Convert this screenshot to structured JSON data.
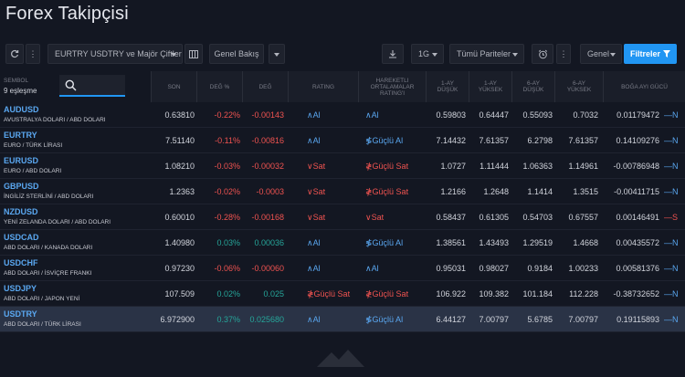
{
  "page": {
    "title": "Forex Takipçisi"
  },
  "toolbar": {
    "list_name": "EURTRY USDTRY ve Majör Çiftler",
    "view": "Genel Bakış",
    "interval": "1G",
    "filter_scope": "Tümü Pariteler",
    "column_set": "Genel",
    "filters_label": "Filtreler"
  },
  "table": {
    "symbol_header": "Sembol",
    "match_count": "9 eşleşme",
    "columns": [
      "Son",
      "Değ %",
      "Değ",
      "Rating",
      "Hareketli Ortalamalar Rating'i",
      "1-Ay Düşük",
      "1-Ay Yüksek",
      "6-Ay Düşük",
      "6-Ay Yüksek",
      "Boğa Ayı Gücü"
    ],
    "rows": [
      {
        "symbol": "AUDUSD",
        "desc": "AVUSTRALYA DOLARI / ABD DOLARI",
        "last": "0.63810",
        "chg_pct": "-0.22%",
        "chg": "-0.00143",
        "rating": "Al",
        "ma_rating": "Al",
        "m1_low": "0.59803",
        "m1_high": "0.64447",
        "m6_low": "0.55093",
        "m6_high": "0.7032",
        "bbp": "0.01179472",
        "tail": "N"
      },
      {
        "symbol": "EURTRY",
        "desc": "EURO / TÜRK LİRASI",
        "last": "7.51140",
        "chg_pct": "-0.11%",
        "chg": "-0.00816",
        "rating": "Al",
        "ma_rating": "Güçlü Al",
        "m1_low": "7.14432",
        "m1_high": "7.61357",
        "m6_low": "6.2798",
        "m6_high": "7.61357",
        "bbp": "0.14109276",
        "tail": "N"
      },
      {
        "symbol": "EURUSD",
        "desc": "EURO / ABD DOLARI",
        "last": "1.08210",
        "chg_pct": "-0.03%",
        "chg": "-0.00032",
        "rating": "Sat",
        "ma_rating": "Güçlü Sat",
        "m1_low": "1.0727",
        "m1_high": "1.11444",
        "m6_low": "1.06363",
        "m6_high": "1.14961",
        "bbp": "-0.00786948",
        "tail": "N"
      },
      {
        "symbol": "GBPUSD",
        "desc": "İNGİLİZ STERLİNİ / ABD DOLARI",
        "last": "1.2363",
        "chg_pct": "-0.02%",
        "chg": "-0.0003",
        "rating": "Sat",
        "ma_rating": "Güçlü Sat",
        "m1_low": "1.2166",
        "m1_high": "1.2648",
        "m6_low": "1.1414",
        "m6_high": "1.3515",
        "bbp": "-0.00411715",
        "tail": "N"
      },
      {
        "symbol": "NZDUSD",
        "desc": "YENİ ZELANDA DOLARI / ABD DOLARI",
        "last": "0.60010",
        "chg_pct": "-0.28%",
        "chg": "-0.00168",
        "rating": "Sat",
        "ma_rating": "Sat",
        "m1_low": "0.58437",
        "m1_high": "0.61305",
        "m6_low": "0.54703",
        "m6_high": "0.67557",
        "bbp": "0.00146491",
        "tail": "S"
      },
      {
        "symbol": "USDCAD",
        "desc": "ABD DOLARI / KANADA DOLARI",
        "last": "1.40980",
        "chg_pct": "0.03%",
        "chg": "0.00036",
        "rating": "Al",
        "ma_rating": "Güçlü Al",
        "m1_low": "1.38561",
        "m1_high": "1.43493",
        "m6_low": "1.29519",
        "m6_high": "1.4668",
        "bbp": "0.00435572",
        "tail": "N"
      },
      {
        "symbol": "USDCHF",
        "desc": "ABD DOLARI / İSVİÇRE FRANKI",
        "last": "0.97230",
        "chg_pct": "-0.06%",
        "chg": "-0.00060",
        "rating": "Al",
        "ma_rating": "Al",
        "m1_low": "0.95031",
        "m1_high": "0.98027",
        "m6_low": "0.9184",
        "m6_high": "1.00233",
        "bbp": "0.00581376",
        "tail": "N"
      },
      {
        "symbol": "USDJPY",
        "desc": "ABD DOLARI / JAPON YENİ",
        "last": "107.509",
        "chg_pct": "0.02%",
        "chg": "0.025",
        "rating": "Güçlü Sat",
        "ma_rating": "Güçlü Sat",
        "m1_low": "106.922",
        "m1_high": "109.382",
        "m6_low": "101.184",
        "m6_high": "112.228",
        "bbp": "-0.38732652",
        "tail": "N"
      },
      {
        "symbol": "USDTRY",
        "desc": "ABD DOLARI / TÜRK LİRASI",
        "last": "6.972900",
        "chg_pct": "0.37%",
        "chg": "0.025680",
        "rating": "Al",
        "ma_rating": "Güçlü Al",
        "m1_low": "6.44127",
        "m1_high": "7.00797",
        "m6_low": "5.6785",
        "m6_high": "7.00797",
        "bbp": "0.19115893",
        "tail": "N"
      }
    ]
  },
  "colors": {
    "accent": "#2196f3",
    "positive": "#26a69a",
    "negative": "#ef5350",
    "buy": "#5aa7f0"
  }
}
